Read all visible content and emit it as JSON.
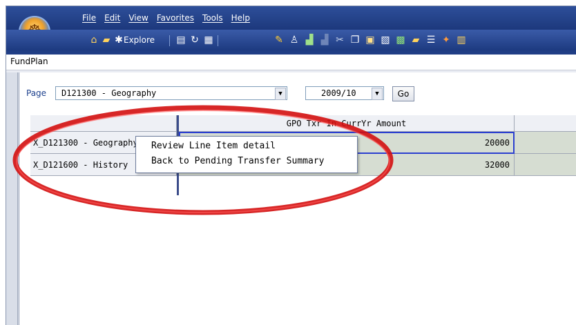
{
  "menu": {
    "items": [
      "File",
      "Edit",
      "View",
      "Favorites",
      "Tools",
      "Help"
    ]
  },
  "toolbar": {
    "explore_label": "Explore",
    "icons": [
      "home-icon",
      "folder-open-icon",
      "explore-icon",
      "save-icon",
      "refresh-icon",
      "print-icon",
      "pencil-icon",
      "user-icon",
      "chart-icon",
      "chart-disabled-icon",
      "scissors-icon",
      "copy-icon",
      "paste-icon",
      "spellcheck-icon",
      "grid-icon",
      "folder-icon",
      "list-icon",
      "pin-icon",
      "layout-icon"
    ]
  },
  "breadcrumb": {
    "text": "FundPlan"
  },
  "page_selector": {
    "label": "Page",
    "page_value": "D121300 - Geography",
    "year_value": "2009/10",
    "go_label": "Go"
  },
  "grid": {
    "column_header": "GPO Txr In CurrYr Amount",
    "rows": [
      {
        "label": "X_D121300 - Geography",
        "value": "20000"
      },
      {
        "label": "X_D121600 - History",
        "value": "32000"
      }
    ]
  },
  "context_menu": {
    "items": [
      "Review Line Item detail",
      "Back to Pending Transfer Summary"
    ]
  },
  "colors": {
    "title_bar": "#1a3578",
    "data_cell": "#d6ddd2",
    "annotation_ellipse": "#e01818"
  }
}
